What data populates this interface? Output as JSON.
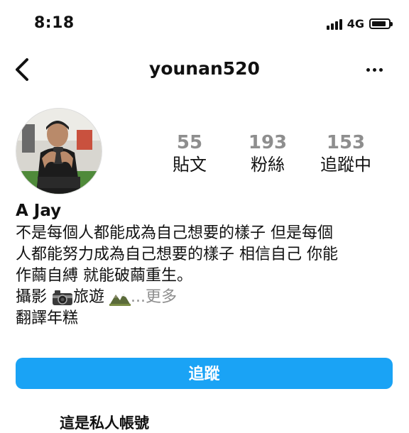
{
  "status_bar": {
    "time": "8:18",
    "network": "4G",
    "battery_level": 0.85
  },
  "header": {
    "username": "younan520"
  },
  "profile": {
    "name": "A Jay",
    "stats": [
      {
        "value": "55",
        "label": "貼文"
      },
      {
        "value": "193",
        "label": "粉絲"
      },
      {
        "value": "153",
        "label": "追蹤中"
      }
    ],
    "bio": {
      "line1": "不是每個人都能成為自己想要的樣子 但是每個",
      "line2": "人都能努力成為自己想要的樣子 相信自己 你能",
      "line3": "作繭自縛 就能破繭重生。",
      "line4_a": "攝影",
      "line4_b": "旅遊",
      "line4_c": "...",
      "more": "更多",
      "line5": "翻譯年糕"
    },
    "icons": [
      "camera-emoji-icon",
      "mountain-emoji-icon"
    ]
  },
  "actions": {
    "follow_label": "追蹤"
  },
  "private_notice": "這是私人帳號",
  "colors": {
    "follow_button": "#1aa3f5",
    "muted": "#8e8e8e"
  }
}
